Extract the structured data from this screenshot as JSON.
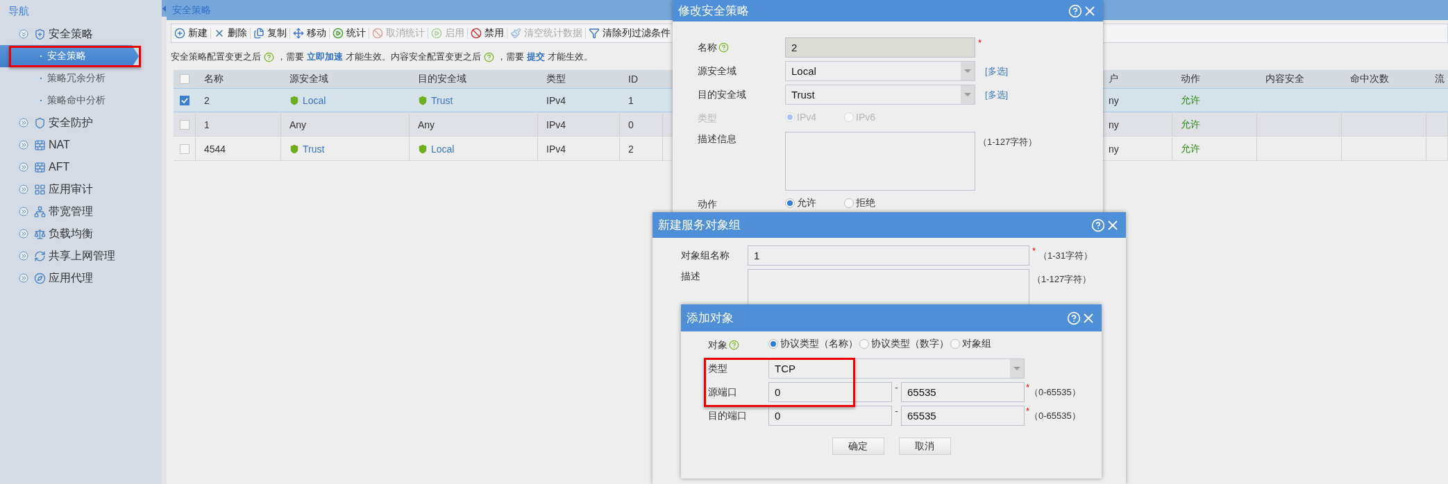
{
  "sidebar": {
    "title": "导航",
    "items": [
      {
        "label": "安全策略",
        "expanded": true,
        "children": [
          {
            "label": "安全策略",
            "selected": true,
            "annotated": true
          },
          {
            "label": "策略冗余分析",
            "selected": false,
            "annotated": false
          },
          {
            "label": "策略命中分析",
            "selected": false,
            "annotated": false
          }
        ]
      },
      {
        "label": "安全防护",
        "expanded": false
      },
      {
        "label": "NAT",
        "expanded": false
      },
      {
        "label": "AFT",
        "expanded": false
      },
      {
        "label": "应用审计",
        "expanded": false
      },
      {
        "label": "带宽管理",
        "expanded": false
      },
      {
        "label": "负载均衡",
        "expanded": false
      },
      {
        "label": "共享上网管理",
        "expanded": false
      },
      {
        "label": "应用代理",
        "expanded": false
      }
    ]
  },
  "main": {
    "title": "安全策略",
    "toolbar": [
      {
        "label": "新建",
        "disabled": false
      },
      {
        "label": "删除",
        "disabled": false
      },
      {
        "label": "复制",
        "disabled": false
      },
      {
        "label": "移动",
        "disabled": false
      },
      {
        "label": "统计",
        "disabled": false
      },
      {
        "label": "取消统计",
        "disabled": true
      },
      {
        "label": "启用",
        "disabled": true
      },
      {
        "label": "禁用",
        "disabled": false
      },
      {
        "label": "清空统计数据",
        "disabled": true
      },
      {
        "label": "清除列过滤条件",
        "disabled": false
      }
    ],
    "notice": [
      {
        "kind": "text",
        "text": "安全策略配置变更之后"
      },
      {
        "kind": "help"
      },
      {
        "kind": "text",
        "text": "，需要"
      },
      {
        "kind": "link",
        "text": "立即加速"
      },
      {
        "kind": "text",
        "text": "才能生效。内容安全配置变更之后"
      },
      {
        "kind": "help"
      },
      {
        "kind": "text",
        "text": "，需要"
      },
      {
        "kind": "link",
        "text": "提交"
      },
      {
        "kind": "text",
        "text": "才能生效。"
      }
    ],
    "table": {
      "all_checked": false,
      "columns": [
        "名称",
        "源安全域",
        "目的安全域",
        "类型",
        "ID",
        "户",
        "动作",
        "内容安全",
        "命中次数",
        "流"
      ],
      "rows": [
        {
          "selected": true,
          "checked": true,
          "cells": [
            {
              "text": "2",
              "kind": "plain"
            },
            {
              "text": "Local",
              "kind": "zone"
            },
            {
              "text": "Trust",
              "kind": "zone"
            },
            {
              "text": "IPv4",
              "kind": "plain"
            },
            {
              "text": "1",
              "kind": "plain"
            },
            {
              "text": "ny",
              "kind": "plain"
            },
            {
              "text": "允许",
              "kind": "action"
            }
          ]
        },
        {
          "selected": false,
          "checked": false,
          "cells": [
            {
              "text": "1",
              "kind": "plain"
            },
            {
              "text": "Any",
              "kind": "plain"
            },
            {
              "text": "Any",
              "kind": "plain"
            },
            {
              "text": "IPv4",
              "kind": "plain"
            },
            {
              "text": "0",
              "kind": "plain"
            },
            {
              "text": "ny",
              "kind": "plain"
            },
            {
              "text": "允许",
              "kind": "action"
            }
          ]
        },
        {
          "selected": false,
          "checked": false,
          "cells": [
            {
              "text": "4544",
              "kind": "plain"
            },
            {
              "text": "Trust",
              "kind": "zone"
            },
            {
              "text": "Local",
              "kind": "zone"
            },
            {
              "text": "IPv4",
              "kind": "plain"
            },
            {
              "text": "2",
              "kind": "plain"
            },
            {
              "text": "ny",
              "kind": "plain"
            },
            {
              "text": "允许",
              "kind": "action"
            }
          ]
        }
      ]
    }
  },
  "edit_policy_dialog": {
    "title": "修改安全策略",
    "fields": [
      {
        "kind": "input",
        "label": "名称",
        "help": true,
        "value": "2",
        "readonly": true,
        "mark": "*"
      },
      {
        "kind": "select",
        "label": "源安全域",
        "value": "Local",
        "link": "[多选]"
      },
      {
        "kind": "select",
        "label": "目的安全域",
        "value": "Trust",
        "link": "[多选]"
      },
      {
        "kind": "radio",
        "label": "类型",
        "disabled": true,
        "options": [
          {
            "label": "IPv4",
            "selected": true
          },
          {
            "label": "IPv6",
            "selected": false
          }
        ]
      },
      {
        "kind": "textarea",
        "label": "描述信息",
        "hint": "（1-127字符）"
      },
      {
        "kind": "radio",
        "label": "动作",
        "disabled": false,
        "options": [
          {
            "label": "允许",
            "selected": true
          },
          {
            "label": "拒绝",
            "selected": false
          }
        ]
      }
    ]
  },
  "service_group_dialog": {
    "title": "新建服务对象组",
    "fields": [
      {
        "kind": "input",
        "label": "对象组名称",
        "value": "1",
        "readonly": false,
        "mark": "*",
        "hint": "（1-31字符）"
      },
      {
        "kind": "textarea",
        "label": "描述",
        "hint": "（1-127字符）"
      }
    ]
  },
  "add_object_dialog": {
    "title": "添加对象",
    "fields": [
      {
        "kind": "radio",
        "label": "对象",
        "help": true,
        "disabled": false,
        "options": [
          {
            "label": "协议类型（名称）",
            "selected": true
          },
          {
            "label": "协议类型（数字）",
            "selected": false
          },
          {
            "label": "对象组",
            "selected": false
          }
        ]
      },
      {
        "kind": "select",
        "label": "类型",
        "value": "TCP",
        "annotated": true
      },
      {
        "kind": "range",
        "label": "源端口",
        "from": "0",
        "separator": "-",
        "to": "65535",
        "mark": "*",
        "hint": "（0-65535）",
        "annotated": true
      },
      {
        "kind": "range",
        "label": "目的端口",
        "from": "0",
        "separator": "-",
        "to": "65535",
        "mark": "*",
        "hint": "（0-65535）"
      }
    ],
    "buttons": [
      "确定",
      "取消"
    ]
  }
}
